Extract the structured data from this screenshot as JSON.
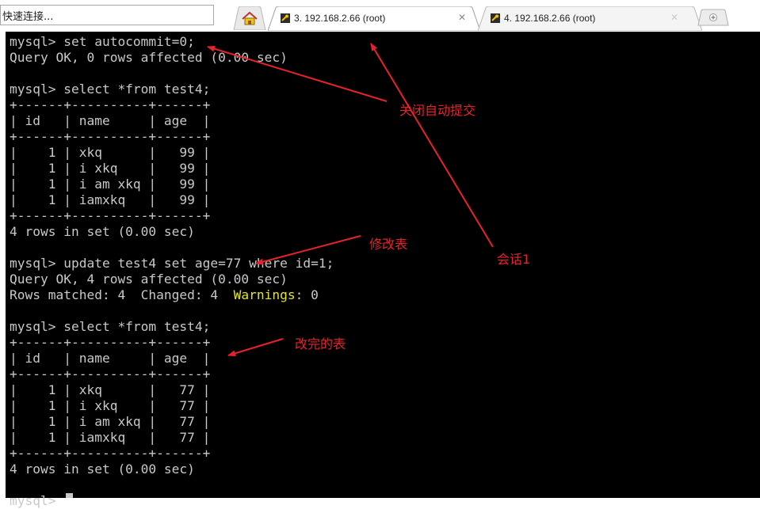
{
  "toolbar": {
    "quick_connect_placeholder": "快速连接..."
  },
  "tabs": [
    {
      "label": "3. 192.168.2.66 (root)",
      "active": true
    },
    {
      "label": "4. 192.168.2.66 (root)",
      "active": false
    }
  ],
  "icons": {
    "home": "home-icon",
    "session": "key-icon",
    "close": "close-icon",
    "new_tab": "plus-icon"
  },
  "colors": {
    "terminal_bg": "#000000",
    "terminal_fg": "#c8c8c8",
    "warning_fg": "#e3e32a",
    "annotation": "#e8222c"
  },
  "terminal": {
    "lines": [
      {
        "text": "mysql> set autocommit=0;"
      },
      {
        "text": "Query OK, 0 rows affected (0.00 sec)"
      },
      {
        "text": ""
      },
      {
        "text": "mysql> select *from test4;"
      },
      {
        "text": "+------+----------+------+"
      },
      {
        "text": "| id   | name     | age  |"
      },
      {
        "text": "+------+----------+------+"
      },
      {
        "text": "|    1 | xkq      |   99 |"
      },
      {
        "text": "|    1 | i xkq    |   99 |"
      },
      {
        "text": "|    1 | i am xkq |   99 |"
      },
      {
        "text": "|    1 | iamxkq   |   99 |"
      },
      {
        "text": "+------+----------+------+"
      },
      {
        "text": "4 rows in set (0.00 sec)"
      },
      {
        "text": ""
      },
      {
        "text": "mysql> update test4 set age=77 where id=1;"
      },
      {
        "text": "Query OK, 4 rows affected (0.00 sec)"
      },
      {
        "pre": "Rows matched: 4  Changed: 4  ",
        "warn": "Warnings",
        "post": ": 0"
      },
      {
        "text": ""
      },
      {
        "text": "mysql> select *from test4;"
      },
      {
        "text": "+------+----------+------+"
      },
      {
        "text": "| id   | name     | age  |"
      },
      {
        "text": "+------+----------+------+"
      },
      {
        "text": "|    1 | xkq      |   77 |"
      },
      {
        "text": "|    1 | i xkq    |   77 |"
      },
      {
        "text": "|    1 | i am xkq |   77 |"
      },
      {
        "text": "|    1 | iamxkq   |   77 |"
      },
      {
        "text": "+------+----------+------+"
      },
      {
        "text": "4 rows in set (0.00 sec)"
      },
      {
        "text": ""
      },
      {
        "text": "mysql> "
      }
    ]
  },
  "annotations": {
    "autocommit_off": "关闭自动提交",
    "modify_table": "修改表",
    "session": "会话1",
    "modified_table": "改完的表"
  }
}
